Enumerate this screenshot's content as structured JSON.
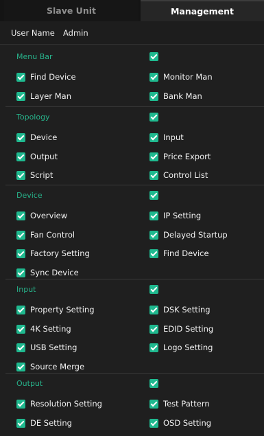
{
  "tabs": [
    {
      "label": "Slave Unit",
      "active": false
    },
    {
      "label": "Management",
      "active": true
    }
  ],
  "user": {
    "label": "User Name",
    "value": "Admin"
  },
  "colors": {
    "accent": "#1fb98f",
    "section_title": "#27b28a",
    "background": "#1f1f1f"
  },
  "sections": [
    {
      "title": "Menu Bar",
      "all_checked": true,
      "items": [
        {
          "label": "Find Device",
          "checked": true
        },
        {
          "label": "Monitor Man",
          "checked": true
        },
        {
          "label": "Layer Man",
          "checked": true
        },
        {
          "label": "Bank Man",
          "checked": true
        }
      ]
    },
    {
      "title": "Topology",
      "all_checked": true,
      "items": [
        {
          "label": "Device",
          "checked": true
        },
        {
          "label": "Input",
          "checked": true
        },
        {
          "label": "Output",
          "checked": true
        },
        {
          "label": "Price Export",
          "checked": true
        },
        {
          "label": "Script",
          "checked": true
        },
        {
          "label": "Control List",
          "checked": true
        }
      ]
    },
    {
      "title": "Device",
      "all_checked": true,
      "items": [
        {
          "label": "Overview",
          "checked": true
        },
        {
          "label": "IP Setting",
          "checked": true
        },
        {
          "label": "Fan Control",
          "checked": true
        },
        {
          "label": "Delayed Startup",
          "checked": true
        },
        {
          "label": "Factory Setting",
          "checked": true
        },
        {
          "label": "Find Device",
          "checked": true
        },
        {
          "label": "Sync Device",
          "checked": true
        }
      ]
    },
    {
      "title": "Input",
      "all_checked": true,
      "items": [
        {
          "label": "Property Setting",
          "checked": true
        },
        {
          "label": "DSK Setting",
          "checked": true
        },
        {
          "label": "4K Setting",
          "checked": true
        },
        {
          "label": "EDID Setting",
          "checked": true
        },
        {
          "label": "USB Setting",
          "checked": true
        },
        {
          "label": "Logo Setting",
          "checked": true
        },
        {
          "label": "Source Merge",
          "checked": true
        }
      ]
    },
    {
      "title": "Output",
      "all_checked": true,
      "items": [
        {
          "label": "Resolution Setting",
          "checked": true
        },
        {
          "label": "Test Pattern",
          "checked": true
        },
        {
          "label": "DE Setting",
          "checked": true
        },
        {
          "label": "OSD Setting",
          "checked": true
        }
      ]
    }
  ]
}
